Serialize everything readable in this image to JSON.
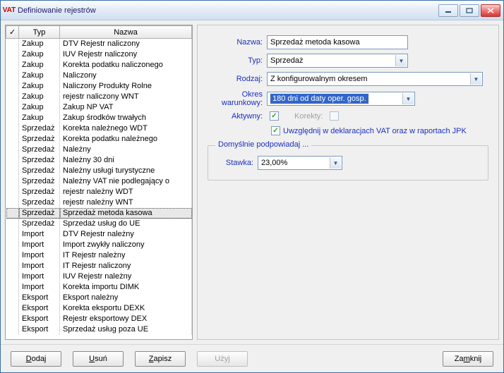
{
  "window": {
    "title": "Definiowanie rejestrów",
    "icon_label": "VAT"
  },
  "table": {
    "headers": {
      "check": "✓",
      "typ": "Typ",
      "nazwa": "Nazwa"
    },
    "selected_index": 14,
    "group_break_after_index": 14,
    "rows": [
      {
        "typ": "Zakup",
        "nazwa": "DTV Rejestr naliczony"
      },
      {
        "typ": "Zakup",
        "nazwa": "IUV Rejestr naliczony"
      },
      {
        "typ": "Zakup",
        "nazwa": "Korekta podatku naliczonego"
      },
      {
        "typ": "Zakup",
        "nazwa": "Naliczony"
      },
      {
        "typ": "Zakup",
        "nazwa": "Naliczony Produkty Rolne"
      },
      {
        "typ": "Zakup",
        "nazwa": "rejestr naliczony WNT"
      },
      {
        "typ": "Zakup",
        "nazwa": "Zakup NP VAT"
      },
      {
        "typ": "Zakup",
        "nazwa": "Zakup środków trwałych"
      },
      {
        "typ": "Sprzedaż",
        "nazwa": "Korekta należnego WDT"
      },
      {
        "typ": "Sprzedaż",
        "nazwa": "Korekta podatku należnego"
      },
      {
        "typ": "Sprzedaż",
        "nazwa": "Należny"
      },
      {
        "typ": "Sprzedaż",
        "nazwa": "Należny 30 dni"
      },
      {
        "typ": "Sprzedaż",
        "nazwa": "Należny usługi turystyczne"
      },
      {
        "typ": "Sprzedaż",
        "nazwa": "Należny VAT nie podlegający o"
      },
      {
        "typ": "Sprzedaż",
        "nazwa": "rejestr należny WDT"
      },
      {
        "typ": "Sprzedaż",
        "nazwa": "rejestr należny WNT"
      },
      {
        "typ": "Sprzedaż",
        "nazwa": "Sprzedaż metoda kasowa"
      },
      {
        "typ": "Sprzedaż",
        "nazwa": "Sprzedaż usług do UE"
      },
      {
        "typ": "Import",
        "nazwa": "DTV Rejestr należny"
      },
      {
        "typ": "Import",
        "nazwa": "Import zwykły naliczony"
      },
      {
        "typ": "Import",
        "nazwa": "IT Rejestr należny"
      },
      {
        "typ": "Import",
        "nazwa": "IT Rejestr naliczony"
      },
      {
        "typ": "Import",
        "nazwa": "IUV Rejestr należny"
      },
      {
        "typ": "Import",
        "nazwa": "Korekta importu DIMK"
      },
      {
        "typ": "Eksport",
        "nazwa": "Eksport należny"
      },
      {
        "typ": "Eksport",
        "nazwa": "Korekta eksportu DEXK"
      },
      {
        "typ": "Eksport",
        "nazwa": "Rejestr eksportowy DEX"
      },
      {
        "typ": "Eksport",
        "nazwa": "Sprzedaż usług poza UE"
      }
    ]
  },
  "form": {
    "labels": {
      "nazwa": "Nazwa:",
      "typ": "Typ:",
      "rodzaj": "Rodzaj:",
      "okres": "Okres warunkowy:",
      "aktywny": "Aktywny:",
      "korekty": "Korekty:",
      "uwzglednij": "Uwzględnij w deklaracjach VAT oraz w raportach JPK",
      "fieldset": "Domyślnie podpowiadaj ...",
      "stawka": "Stawka:"
    },
    "values": {
      "nazwa": "Sprzedaż metoda kasowa",
      "typ": "Sprzedaż",
      "rodzaj": "Z konfigurowalnym okresem",
      "okres": "180 dni od daty oper. gosp.",
      "aktywny_checked": true,
      "korekty_checked": false,
      "korekty_enabled": false,
      "uwzglednij_checked": true,
      "stawka": "23,00%"
    }
  },
  "buttons": {
    "dodaj": "Dodaj",
    "usun": "Usuń",
    "zapisz": "Zapisz",
    "uzyj": "Użyj",
    "zamknij": "Zamknij",
    "uzyj_enabled": false
  }
}
